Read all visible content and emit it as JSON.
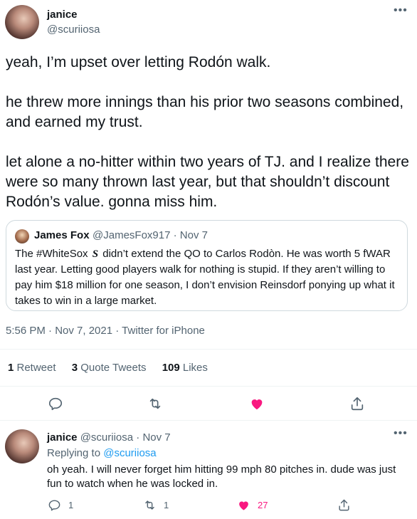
{
  "main_tweet": {
    "author_name": "janice",
    "author_handle": "@scuriiosa",
    "paragraphs": [
      "yeah, I’m upset over letting Rodón walk.",
      "he threw more innings than his prior two seasons combined, and earned my trust.",
      "let alone a no-hitter within two years of TJ. and I realize there were so many thrown last year, but that shouldn’t discount Rodón’s value. gonna miss him."
    ],
    "timestamp": "5:56 PM · Nov 7, 2021",
    "source_sep": " · ",
    "source": "Twitter for iPhone"
  },
  "quote": {
    "author_name": "James Fox",
    "meta": "@JamesFox917 · Nov 7",
    "text_before": "The #WhiteSox ",
    "logo_text": "S",
    "text_after": " didn’t extend the QO to Carlos Rodòn. He was worth 5 fWAR last year. Letting good players walk for nothing is stupid. If they aren’t willing to pay him $18 million for one season, I don’t envision Reinsdorf ponying up what it takes to win in a large market."
  },
  "stats": {
    "retweets_num": "1",
    "retweets_label": " Retweet",
    "quotes_num": "3",
    "quotes_label": " Quote Tweets",
    "likes_num": "109",
    "likes_label": " Likes"
  },
  "reply_tweet": {
    "author_name": "janice",
    "meta": " @scuriiosa · Nov 7",
    "replying_label": "Replying to ",
    "replying_handle": "@scuriiosa",
    "text": "oh yeah. I will never forget him hitting 99 mph 80 pitches in. dude was just fun to watch when he was locked in.",
    "reply_count": "1",
    "retweet_count": "1",
    "like_count": "27"
  },
  "colors": {
    "like_pink": "#f91880",
    "muted": "#536471",
    "link_blue": "#1d9bf0"
  }
}
